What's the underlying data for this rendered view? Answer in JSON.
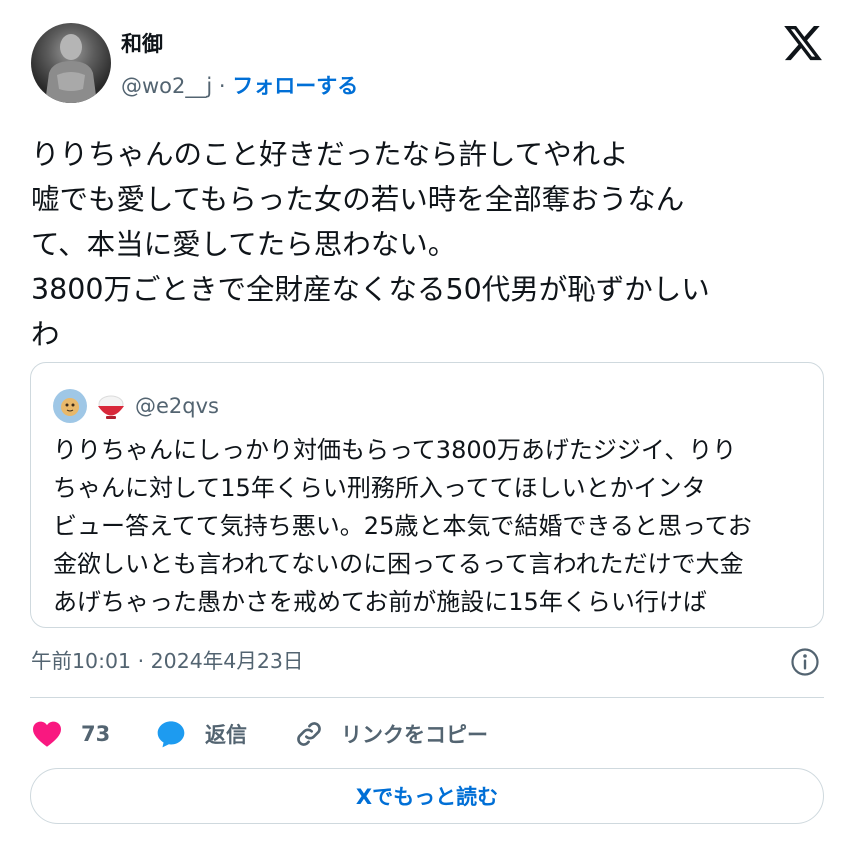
{
  "author": {
    "name": "和御",
    "handle": "@wo2__j",
    "separator": "·",
    "follow_label": "フォローする"
  },
  "tweet": {
    "text": "りりちゃんのこと好きだったなら許してやれよ\n嘘でも愛してもらった女の若い時を全部奪おうなん\nて、本当に愛してたら思わない。\n3800万ごときで全財産なくなる50代男が恥ずかしい\nわ",
    "timestamp": "午前10:01 · 2024年4月23日"
  },
  "quote": {
    "handle": "@e2qvs",
    "text": "りりちゃんにしっかり対価もらって3800万あげたジジイ、りり\nちゃんに対して15年くらい刑務所入っててほしいとかインタ\nビュー答えてて気持ち悪い。25歳と本気で結婚できると思ってお\n金欲しいとも言われてないのに困ってるって言われただけで大金\nあげちゃった愚かさを戒めてお前が施設に15年くらい行けば"
  },
  "actions": {
    "likes": "73",
    "reply_label": "返信",
    "copy_link_label": "リンクをコピー"
  },
  "read_more_label": "Xでもっと読む",
  "colors": {
    "like": "#f91880",
    "reply": "#1d9bf0",
    "link": "#006fd6",
    "muted": "#536471"
  },
  "icons": [
    "x-logo-icon",
    "info-icon",
    "heart-icon",
    "reply-bubble-icon",
    "link-icon"
  ]
}
